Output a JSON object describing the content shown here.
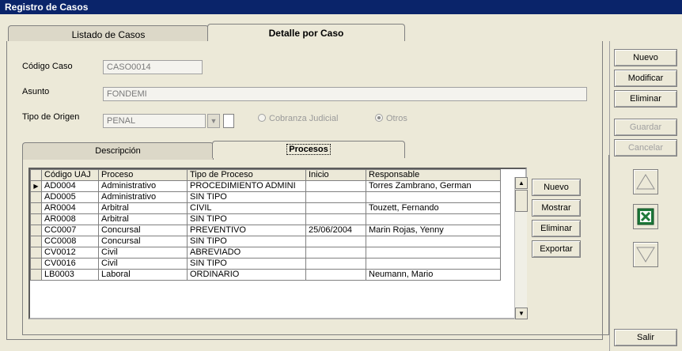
{
  "window": {
    "title": "Registro de Casos"
  },
  "main_tabs": [
    {
      "label": "Listado de Casos"
    },
    {
      "label": "Detalle por Caso"
    }
  ],
  "form": {
    "codigo_label": "Código Caso",
    "codigo_value": "CASO0014",
    "asunto_label": "Asunto",
    "asunto_value": "FONDEMI",
    "tipo_origen_label": "Tipo de Origen",
    "tipo_origen_value": "PENAL",
    "radio_cobranza": "Cobranza Judicial",
    "radio_otros": "Otros"
  },
  "sub_tabs": [
    {
      "label": "Descripción"
    },
    {
      "label": "Procesos"
    }
  ],
  "grid": {
    "columns": [
      "Código UAJ",
      "Proceso",
      "Tipo de Proceso",
      "Inicio",
      "Responsable"
    ],
    "rows": [
      [
        "AD0004",
        "Administrativo",
        "PROCEDIMIENTO ADMINI",
        "",
        "Torres Zambrano, German"
      ],
      [
        "AD0005",
        "Administrativo",
        "SIN TIPO",
        "",
        ""
      ],
      [
        "AR0004",
        "Arbitral",
        "CIVIL",
        "",
        "Touzett, Fernando"
      ],
      [
        "AR0008",
        "Arbitral",
        "SIN TIPO",
        "",
        ""
      ],
      [
        "CC0007",
        "Concursal",
        "PREVENTIVO",
        "25/06/2004",
        "Marin Rojas, Yenny"
      ],
      [
        "CC0008",
        "Concursal",
        "SIN TIPO",
        "",
        ""
      ],
      [
        "CV0012",
        "Civil",
        "ABREVIADO",
        "",
        ""
      ],
      [
        "CV0016",
        "Civil",
        "SIN TIPO",
        "",
        ""
      ],
      [
        "LB0003",
        "Laboral",
        "ORDINARIO",
        "",
        "Neumann, Mario"
      ]
    ]
  },
  "grid_buttons": {
    "nuevo": "Nuevo",
    "mostrar": "Mostrar",
    "eliminar": "Eliminar",
    "exportar": "Exportar"
  },
  "side_buttons": {
    "nuevo": "Nuevo",
    "modificar": "Modificar",
    "eliminar": "Eliminar",
    "guardar": "Guardar",
    "cancelar": "Cancelar",
    "salir": "Salir"
  },
  "icons": {
    "up": "up-arrow-icon",
    "excel": "excel-icon",
    "down": "down-arrow-icon"
  }
}
